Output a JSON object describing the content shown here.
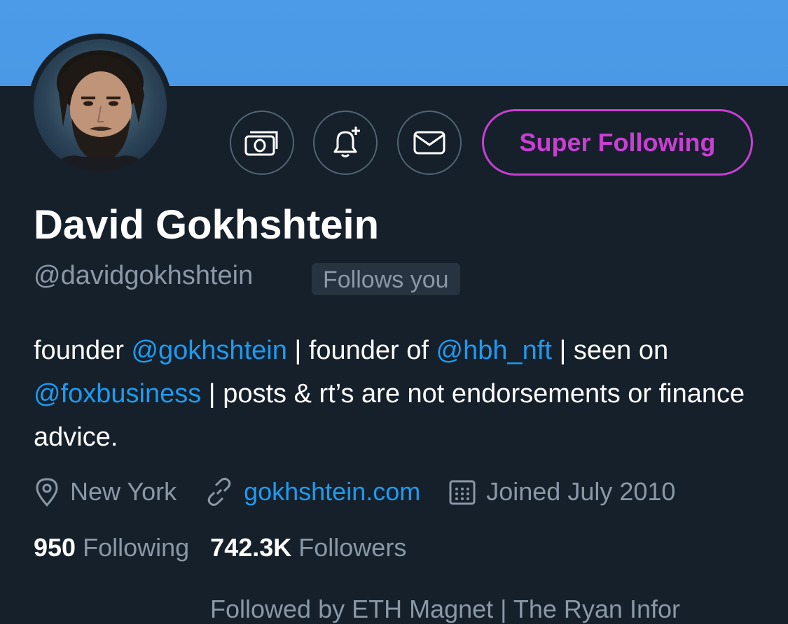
{
  "profile": {
    "display_name": "David Gokhshtein",
    "handle": "@davidgokhshtein",
    "follows_you": "Follows you",
    "super_following_label": "Super Following",
    "bio": {
      "part1": "founder ",
      "mention1": "@gokhshtein",
      "part2": " | founder of ",
      "mention2": "@hbh_nft",
      "part3": " | seen on ",
      "mention3": "@foxbusiness",
      "part4": " | posts & rt’s are not endorsements or finance advice."
    },
    "location": "New York",
    "website": "gokhshtein.com",
    "joined": "Joined July 2010",
    "following_count": "950",
    "following_label": "Following",
    "followers_count": "742.3K",
    "followers_label": "Followers",
    "followed_by": "Followed by ETH Magnet | The Ryan Infor"
  },
  "icons": [
    "tip-money-icon",
    "notification-bell-plus-icon",
    "mail-icon",
    "location-pin-icon",
    "link-icon",
    "calendar-icon"
  ],
  "colors": {
    "banner": "#4a99e6",
    "background": "#15202b",
    "accent_link": "#1d9bf0",
    "super_follow": "#c83fd2",
    "muted_text": "#8b98a5",
    "button_border": "#536471"
  }
}
